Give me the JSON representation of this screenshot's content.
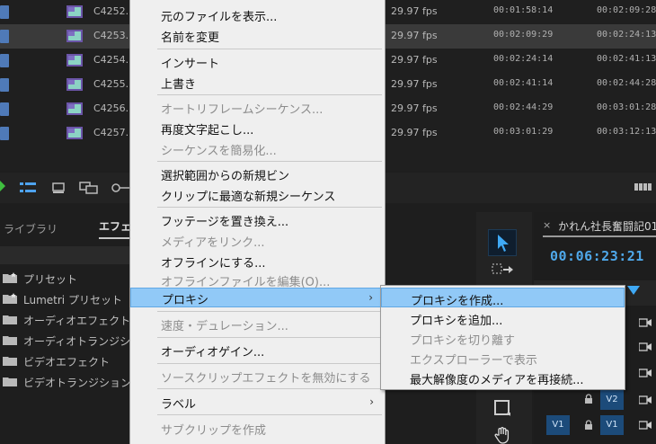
{
  "clips": [
    {
      "name": "C4252.",
      "fps": "29.97 fps",
      "start": "00:01:58:14",
      "end": "00:02:09:28",
      "selected": false
    },
    {
      "name": "C4253.",
      "fps": "29.97 fps",
      "start": "00:02:09:29",
      "end": "00:02:24:13",
      "selected": true
    },
    {
      "name": "C4254.",
      "fps": "29.97 fps",
      "start": "00:02:24:14",
      "end": "00:02:41:13",
      "selected": false
    },
    {
      "name": "C4255.",
      "fps": "29.97 fps",
      "start": "00:02:41:14",
      "end": "00:02:44:28",
      "selected": false
    },
    {
      "name": "C4256.",
      "fps": "29.97 fps",
      "start": "00:02:44:29",
      "end": "00:03:01:28",
      "selected": false
    },
    {
      "name": "C4257.",
      "fps": "29.97 fps",
      "start": "00:03:01:29",
      "end": "00:03:12:13",
      "selected": false
    }
  ],
  "lower_left": {
    "tab_library": "ライブラリ",
    "tab_effects": "エフェ",
    "items": [
      {
        "label": "プリセット",
        "icon": "preset-folder-icon"
      },
      {
        "label": "Lumetri プリセット",
        "icon": "preset-folder-icon"
      },
      {
        "label": "オーディオエフェクト",
        "icon": "folder-icon"
      },
      {
        "label": "オーディオトランジション",
        "icon": "folder-icon"
      },
      {
        "label": "ビデオエフェクト",
        "icon": "folder-icon"
      },
      {
        "label": "ビデオトランジション",
        "icon": "folder-icon"
      }
    ]
  },
  "menu": {
    "items": [
      {
        "label": "元のファイルを表示...",
        "disabled": false
      },
      {
        "label": "名前を変更",
        "disabled": false
      },
      {
        "label": "インサート",
        "disabled": false
      },
      {
        "label": "上書き",
        "disabled": false
      },
      {
        "label": "オートリフレームシーケンス...",
        "disabled": true
      },
      {
        "label": "再度文字起こし...",
        "disabled": false
      },
      {
        "label": "シーケンスを簡易化...",
        "disabled": true
      },
      {
        "label": "選択範囲からの新規ビン",
        "disabled": false
      },
      {
        "label": "クリップに最適な新規シーケンス",
        "disabled": false
      },
      {
        "label": "フッテージを置き換え...",
        "disabled": false
      },
      {
        "label": "メディアをリンク...",
        "disabled": true
      },
      {
        "label": "オフラインにする...",
        "disabled": false
      },
      {
        "label": "オフラインファイルを編集(O)...",
        "disabled": true
      },
      {
        "label": "プロキシ",
        "disabled": false
      },
      {
        "label": "速度・デュレーション...",
        "disabled": true
      },
      {
        "label": "オーディオゲイン...",
        "disabled": false
      },
      {
        "label": "ソースクリップエフェクトを無効にする",
        "disabled": true
      },
      {
        "label": "ラベル",
        "disabled": false
      },
      {
        "label": "サブクリップを作成",
        "disabled": true
      }
    ],
    "submenu_arrow": "›"
  },
  "submenu": {
    "items": [
      {
        "label": "プロキシを作成...",
        "disabled": false
      },
      {
        "label": "プロキシを追加...",
        "disabled": false
      },
      {
        "label": "プロキシを切り離す",
        "disabled": true
      },
      {
        "label": "エクスプローラーで表示",
        "disabled": true
      },
      {
        "label": "最大解像度のメディアを再接続...",
        "disabled": false
      }
    ]
  },
  "timeline": {
    "close": "×",
    "title": "かれん社長奮闘記01",
    "timecode": "00:06:23:21",
    "tracks": [
      "V2",
      "V1"
    ],
    "source_patch": "V1"
  },
  "colors": {
    "accent_blue": "#4fa8ea",
    "menu_bg": "#efefef",
    "menu_highlight": "#91c9f7",
    "track_blue": "#1c4b7a"
  }
}
